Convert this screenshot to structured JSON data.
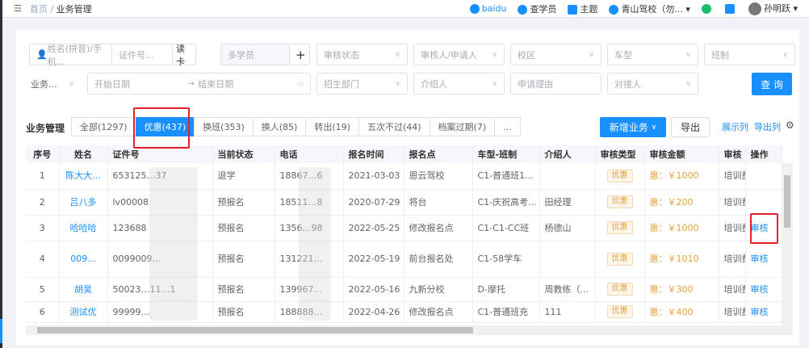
{
  "topbar": {
    "crumb_home": "首页",
    "crumb_sep": "/",
    "crumb_current": "业务管理",
    "baidu": "baidu",
    "search_student": "查学员",
    "theme": "主题",
    "school": "青山驾校（勿...",
    "user": "孙明跃"
  },
  "filters": {
    "name_placeholder": "姓名(拼音)/手机...",
    "id_placeholder": "证件号...",
    "read_card": "读卡",
    "multi_student": "多学员",
    "plus": "+",
    "audit_status": "审核状态",
    "auditor": "审核人/申请人",
    "campus": "校区",
    "car_type": "车型",
    "class": "班制",
    "biz": "业务...",
    "start_date": "开始日期",
    "arrow": "→",
    "end_date": "结束日期",
    "dept": "招生部门",
    "referrer": "介绍人",
    "reason": "申请理由",
    "contact": "对接人",
    "query": "查 询"
  },
  "section_title": "业务管理",
  "tabs": [
    {
      "label": "全部(1297)"
    },
    {
      "label": "优惠(437)"
    },
    {
      "label": "换班(353)"
    },
    {
      "label": "换人(85)"
    },
    {
      "label": "转出(19)"
    },
    {
      "label": "五次不过(44)"
    },
    {
      "label": "档案过期(7)"
    },
    {
      "label": "..."
    }
  ],
  "actions": {
    "new_business": "新增业务",
    "export": "导出",
    "show_cols": "展示列",
    "export_cols": "导出列"
  },
  "columns": [
    "序号",
    "姓名",
    "证件号",
    "当前状态",
    "电话",
    "报名时间",
    "报名点",
    "车型-班制",
    "介绍人",
    "审核类型",
    "审核金额",
    "审核",
    "操作"
  ],
  "rows": [
    {
      "no": "1",
      "name": "陈大大...",
      "id": "653125…37",
      "status": "退学",
      "phone": "18867…6",
      "date": "2021-03-03",
      "site": "恩云驾校",
      "car": "C1-普通班1...",
      "ref": "",
      "type": "优惠",
      "amount": "惠：￥1000",
      "audit": "培训费",
      "op": ""
    },
    {
      "no": "2",
      "name": "吕八多",
      "id": "lv00008",
      "status": "预报名",
      "phone": "18511…8",
      "date": "2020-07-29",
      "site": "将台",
      "car": "C1-庆祝高考...",
      "ref": "田经理",
      "type": "优惠",
      "amount": "惠：￥200",
      "audit": "培训费",
      "op": ""
    },
    {
      "no": "3",
      "name": "哈哈哈",
      "id": "123688",
      "status": "预报名",
      "phone": "1356…98",
      "date": "2022-05-25",
      "site": "修改报名点",
      "car": "C1-C1-CC班",
      "ref": "杨德山",
      "type": "优惠",
      "amount": "惠：￥1000",
      "audit": "培训费",
      "op": "审核"
    },
    {
      "no": "4",
      "name": "009...",
      "id": "0099009…",
      "status": "预报名",
      "phone": "131221…",
      "date": "2022-05-19",
      "site": "前台报名处",
      "car": "C1-58学车",
      "ref": "",
      "type": "优惠",
      "amount": "惠：￥1010",
      "audit": "培训费 本费",
      "op": "审核"
    },
    {
      "no": "5",
      "name": "胡昊",
      "id": "50023…11…1",
      "status": "预报名",
      "phone": "139967…",
      "date": "2022-05-16",
      "site": "九新分校",
      "car": "D-摩托",
      "ref": "周教练（...",
      "type": "优惠",
      "amount": "惠：￥300",
      "audit": "培训费",
      "op": "审核"
    },
    {
      "no": "6",
      "name": "测试优",
      "id": "99999…",
      "status": "预报名",
      "phone": "188888…",
      "date": "2022-04-26",
      "site": "修改报名点",
      "car": "C1-普通班充",
      "ref": "111",
      "type": "优惠",
      "amount": "惠：￥400",
      "audit": "培训费",
      "op": "审核"
    }
  ]
}
